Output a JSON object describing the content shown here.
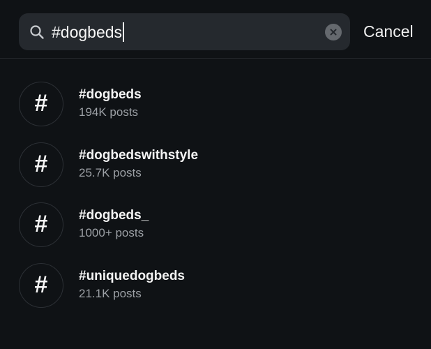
{
  "search": {
    "query": "#dogbeds",
    "cancel_label": "Cancel"
  },
  "results": [
    {
      "icon": "#",
      "tag": "#dogbeds",
      "posts": "194K posts"
    },
    {
      "icon": "#",
      "tag": "#dogbedswithstyle",
      "posts": "25.7K posts"
    },
    {
      "icon": "#",
      "tag": "#dogbeds_",
      "posts": "1000+ posts"
    },
    {
      "icon": "#",
      "tag": "#uniquedogbeds",
      "posts": "21.1K posts"
    }
  ],
  "icons": {
    "search": "search-icon",
    "clear": "clear-icon",
    "hashtag": "hashtag-icon"
  },
  "colors": {
    "background": "#0f1215",
    "search_field": "#25292e",
    "secondary_text": "#9ca0a5"
  }
}
